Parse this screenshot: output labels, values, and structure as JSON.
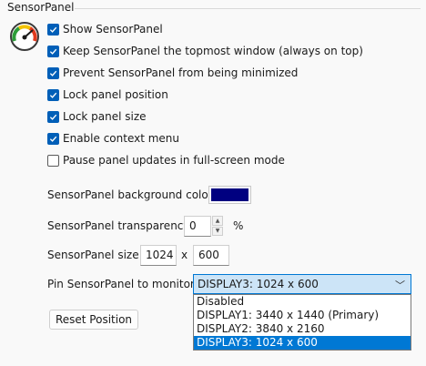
{
  "group": {
    "title": "SensorPanel"
  },
  "checkboxes": [
    {
      "label": "Show SensorPanel",
      "checked": true
    },
    {
      "label": "Keep SensorPanel the topmost window (always on top)",
      "checked": true
    },
    {
      "label": "Prevent SensorPanel from being minimized",
      "checked": true
    },
    {
      "label": "Lock panel position",
      "checked": true
    },
    {
      "label": "Lock panel size",
      "checked": true
    },
    {
      "label": "Enable context menu",
      "checked": true
    },
    {
      "label": "Pause panel updates in full-screen mode",
      "checked": false
    }
  ],
  "background": {
    "label": "SensorPanel background color:",
    "color": "#000080"
  },
  "transparency": {
    "label": "SensorPanel transparency:",
    "value": "0",
    "unit": "%"
  },
  "size": {
    "label": "SensorPanel size:",
    "width": "1024",
    "x": "x",
    "height": "600"
  },
  "monitor": {
    "label": "Pin SensorPanel to monitor:",
    "selected": "DISPLAY3: 1024 x 600",
    "options": [
      "Disabled",
      "DISPLAY1: 3440 x 1440 (Primary)",
      "DISPLAY2: 3840 x 2160",
      "DISPLAY3: 1024 x 600"
    ],
    "selected_index": 3
  },
  "reset_button": {
    "label": "Reset Position"
  },
  "colors": {
    "accent": "#005fb8",
    "selection": "#0078d4",
    "select_bg": "#cce4f7"
  },
  "icons": {
    "app": "gauge-icon",
    "check": "checkmark-icon",
    "chevron": "chevron-down-icon"
  }
}
